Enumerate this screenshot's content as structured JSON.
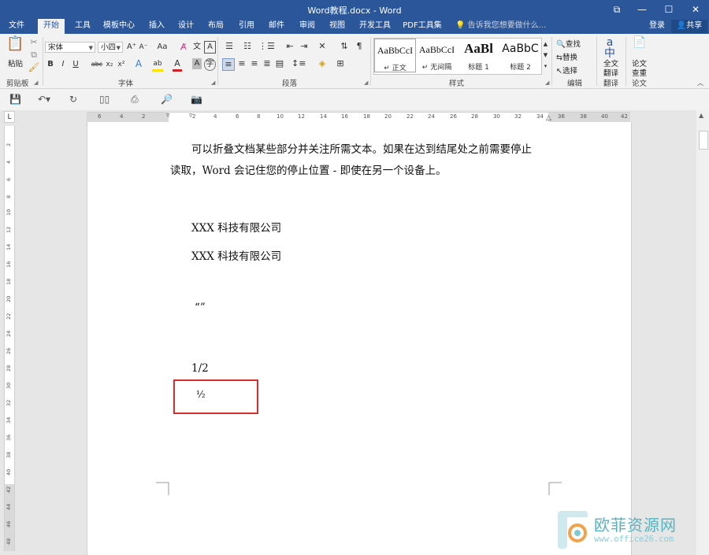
{
  "window": {
    "title": "Word教程.docx - Word",
    "controls": [
      "restore-ribbon-icon",
      "minimize-icon",
      "maximize-icon",
      "close-icon"
    ]
  },
  "tabs": [
    {
      "label": "文件"
    },
    {
      "label": "开始"
    },
    {
      "label": "工具"
    },
    {
      "label": "模板中心"
    },
    {
      "label": "插入"
    },
    {
      "label": "设计"
    },
    {
      "label": "布局"
    },
    {
      "label": "引用"
    },
    {
      "label": "邮件"
    },
    {
      "label": "审阅"
    },
    {
      "label": "视图"
    },
    {
      "label": "开发工具"
    },
    {
      "label": "PDF工具集"
    }
  ],
  "tell_me": "告诉我您想要做什么...",
  "login_label": "登录",
  "share_label": "共享",
  "ribbon": {
    "clipboard": {
      "paste_label": "粘贴",
      "group": "剪贴板"
    },
    "font": {
      "font_name": "宋体",
      "font_size": "小四",
      "group": "字体",
      "buttons": [
        "B",
        "I",
        "U",
        "abc",
        "x₂",
        "x²",
        "A",
        "A",
        "Aa",
        "A"
      ]
    },
    "paragraph": {
      "group": "段落"
    },
    "styles": {
      "group": "样式",
      "items": [
        {
          "sample": "AaBbCcI",
          "name": "↵ 正文"
        },
        {
          "sample": "AaBbCcI",
          "name": "↵ 无间隔"
        },
        {
          "sample": "AaBl",
          "name": "标题 1"
        },
        {
          "sample": "AaBbC",
          "name": "标题 2"
        }
      ]
    },
    "editing": {
      "find": "查找",
      "replace": "替换",
      "select": "选择",
      "group": "编辑"
    },
    "translate": {
      "label1": "全文",
      "label2": "翻译",
      "group": "翻译"
    },
    "paper": {
      "label1": "论文",
      "label2": "查重",
      "group": "论文"
    }
  },
  "ruler": {
    "h_ticks": [
      "6",
      "4",
      "2",
      "2",
      "4",
      "6",
      "8",
      "10",
      "12",
      "14",
      "16",
      "18",
      "20",
      "22",
      "24",
      "26",
      "28",
      "30",
      "32",
      "34",
      "36",
      "38",
      "40",
      "42"
    ],
    "v_ticks": [
      "2",
      "4",
      "6",
      "8",
      "10",
      "12",
      "14",
      "16",
      "18",
      "20",
      "22",
      "24",
      "26",
      "28",
      "30",
      "32",
      "34",
      "36",
      "38",
      "40",
      "42",
      "44",
      "46",
      "48"
    ]
  },
  "document": {
    "lines": [
      "可以折叠文档某些部分并关注所需文本。如果在达到结尾处之前需要停止",
      "读取，Word 会记住您的停止位置 - 即使在另一个设备上。",
      "XXX 科技有限公司",
      "XXX 科技有限公司",
      "“”",
      "1/2",
      "½"
    ]
  },
  "watermark": {
    "text": "欧菲资源网",
    "url": "www.office26.com"
  },
  "colors": {
    "accent": "#2b579a",
    "highlight": "#d92e2e",
    "watermark": "#56b4c1"
  }
}
